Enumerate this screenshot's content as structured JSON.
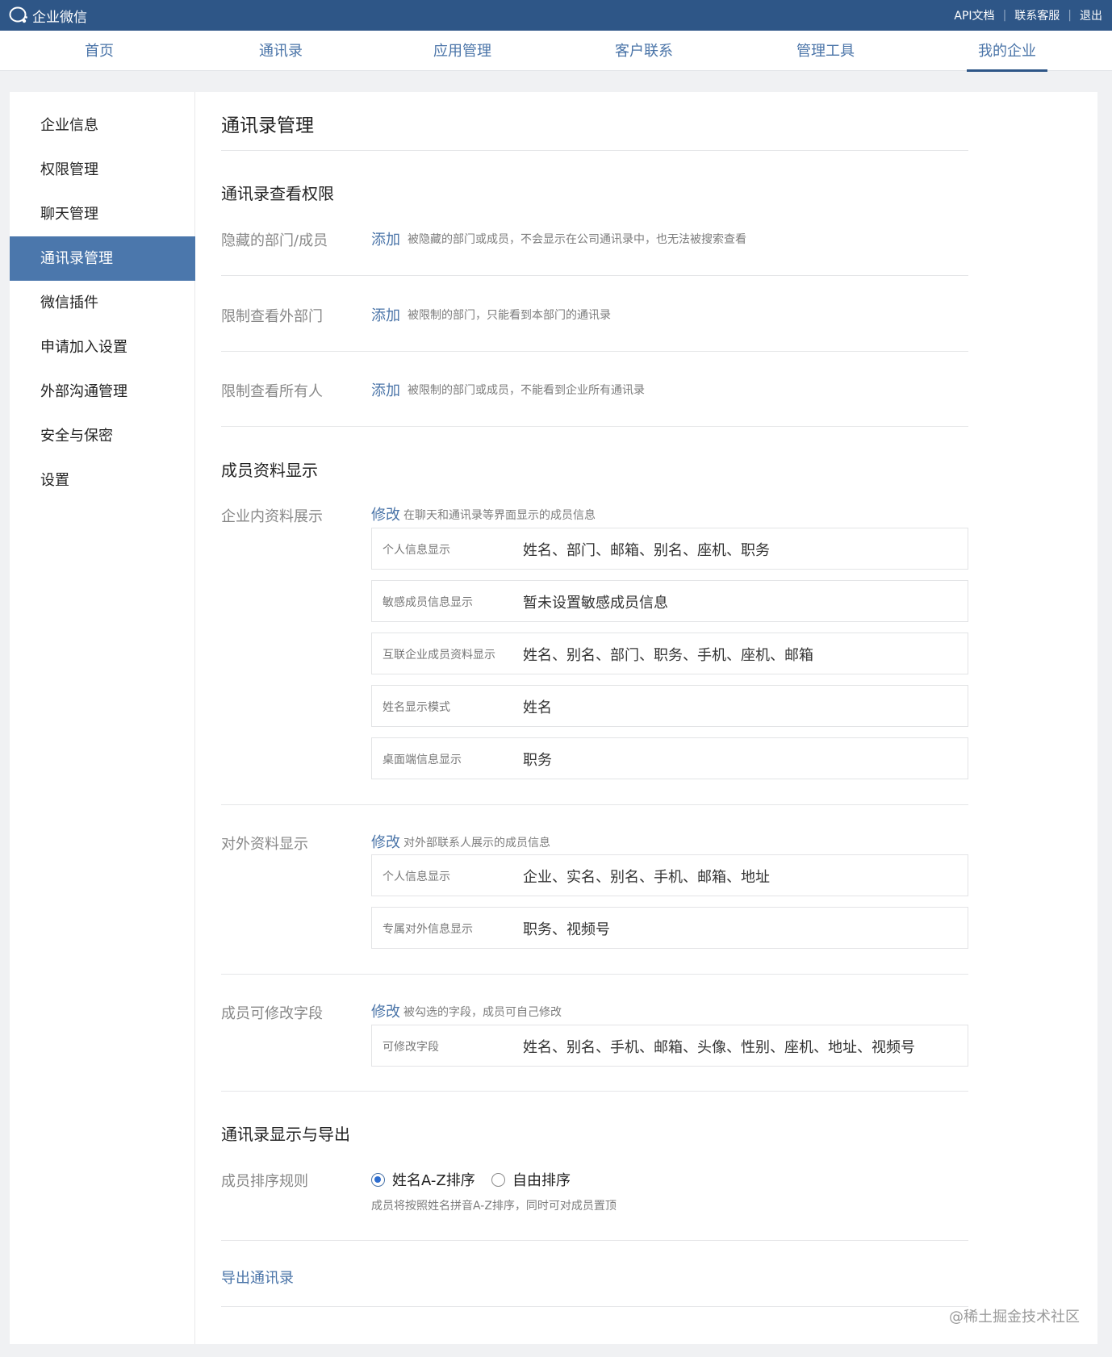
{
  "app": {
    "logo_text": "企业微信",
    "accent": "#2e5687",
    "link_color": "#4a74a8"
  },
  "top_links": [
    "API文档",
    "联系客服",
    "退出"
  ],
  "nav": {
    "items": [
      {
        "label": "首页"
      },
      {
        "label": "通讯录"
      },
      {
        "label": "应用管理"
      },
      {
        "label": "客户联系"
      },
      {
        "label": "管理工具"
      },
      {
        "label": "我的企业",
        "active": true
      }
    ]
  },
  "sidebar": {
    "items": [
      {
        "label": "企业信息"
      },
      {
        "label": "权限管理"
      },
      {
        "label": "聊天管理"
      },
      {
        "label": "通讯录管理",
        "active": true
      },
      {
        "label": "微信插件"
      },
      {
        "label": "申请加入设置"
      },
      {
        "label": "外部沟通管理"
      },
      {
        "label": "安全与保密"
      },
      {
        "label": "设置"
      }
    ]
  },
  "main": {
    "title": "通讯录管理",
    "view_perm": {
      "title": "通讯录查看权限",
      "rows": [
        {
          "label": "隐藏的部门/成员",
          "action": "添加",
          "hint": "被隐藏的部门或成员，不会显示在公司通讯录中，也无法被搜索查看"
        },
        {
          "label": "限制查看外部门",
          "action": "添加",
          "hint": "被限制的部门，只能看到本部门的通讯录"
        },
        {
          "label": "限制查看所有人",
          "action": "添加",
          "hint": "被限制的部门或成员，不能看到企业所有通讯录"
        }
      ]
    },
    "member_display": {
      "title": "成员资料显示",
      "internal": {
        "label": "企业内资料展示",
        "action": "修改",
        "hint": "在聊天和通讯录等界面显示的成员信息",
        "fields": [
          {
            "label": "个人信息显示",
            "value": "姓名、部门、邮箱、别名、座机、职务"
          },
          {
            "label": "敏感成员信息显示",
            "value": "暂未设置敏感成员信息"
          },
          {
            "label": "互联企业成员资料显示",
            "value": "姓名、别名、部门、职务、手机、座机、邮箱"
          },
          {
            "label": "姓名显示模式",
            "value": "姓名"
          },
          {
            "label": "桌面端信息显示",
            "value": "职务"
          }
        ]
      },
      "external": {
        "label": "对外资料显示",
        "action": "修改",
        "hint": "对外部联系人展示的成员信息",
        "fields": [
          {
            "label": "个人信息显示",
            "value": "企业、实名、别名、手机、邮箱、地址"
          },
          {
            "label": "专属对外信息显示",
            "value": "职务、视频号"
          }
        ]
      },
      "editable": {
        "label": "成员可修改字段",
        "action": "修改",
        "hint": "被勾选的字段，成员可自己修改",
        "fields": [
          {
            "label": "可修改字段",
            "value": "姓名、别名、手机、邮箱、头像、性别、座机、地址、视频号"
          }
        ]
      }
    },
    "display_export": {
      "title": "通讯录显示与导出",
      "sort_label": "成员排序规则",
      "sort_options": [
        {
          "label": "姓名A-Z排序",
          "checked": true
        },
        {
          "label": "自由排序",
          "checked": false
        }
      ],
      "sort_hint": "成员将按照姓名拼音A-Z排序，同时可对成员置顶",
      "export_label": "导出通讯录"
    }
  },
  "watermark": "@稀土掘金技术社区"
}
